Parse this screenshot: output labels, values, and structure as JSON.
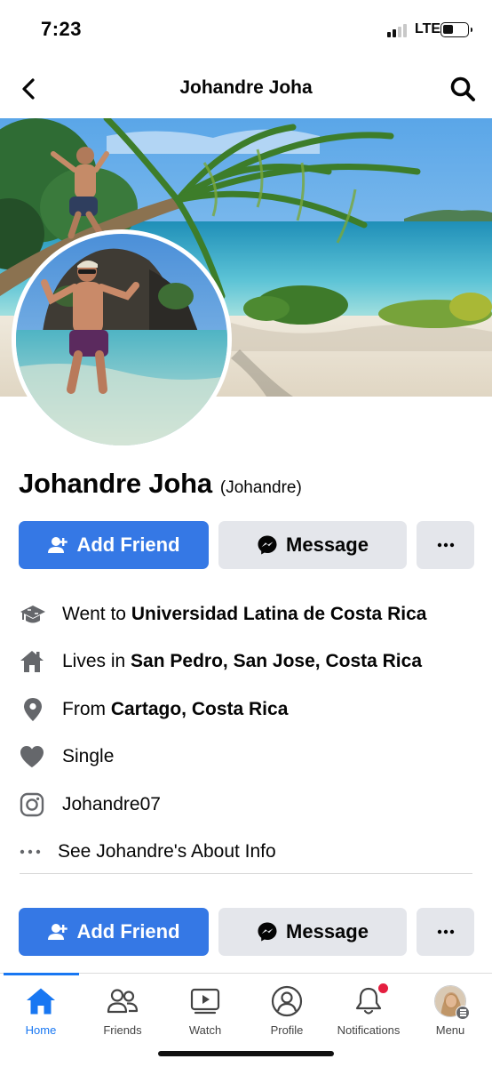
{
  "status_bar": {
    "time": "7:23",
    "network": "LTE"
  },
  "header": {
    "title": "Johandre Joha"
  },
  "profile": {
    "name": "Johandre Joha",
    "alternate_name": "(Johandre)",
    "add_friend_label": "Add Friend",
    "message_label": "Message"
  },
  "details": {
    "education": {
      "prefix": "Went to ",
      "value": "Universidad Latina de Costa Rica"
    },
    "lives": {
      "prefix": "Lives in ",
      "value": "San Pedro, San Jose, Costa Rica"
    },
    "from": {
      "prefix": "From ",
      "value": "Cartago, Costa Rica"
    },
    "relationship": {
      "value": "Single"
    },
    "instagram": {
      "value": "Johandre07"
    },
    "about": {
      "value": "See Johandre's About Info"
    }
  },
  "tabs": [
    {
      "label": "Home",
      "icon": "home-icon",
      "active": true
    },
    {
      "label": "Friends",
      "icon": "friends-icon"
    },
    {
      "label": "Watch",
      "icon": "watch-icon"
    },
    {
      "label": "Profile",
      "icon": "profile-icon"
    },
    {
      "label": "Notifications",
      "icon": "bell-icon"
    },
    {
      "label": "Menu",
      "icon": "menu-avatar-icon"
    }
  ],
  "colors": {
    "primary": "#3578e5",
    "secondary_button": "#e4e6eb",
    "tab_active": "#1877f2",
    "notification_dot": "#e41e3f",
    "icon_gray": "#65676b"
  }
}
